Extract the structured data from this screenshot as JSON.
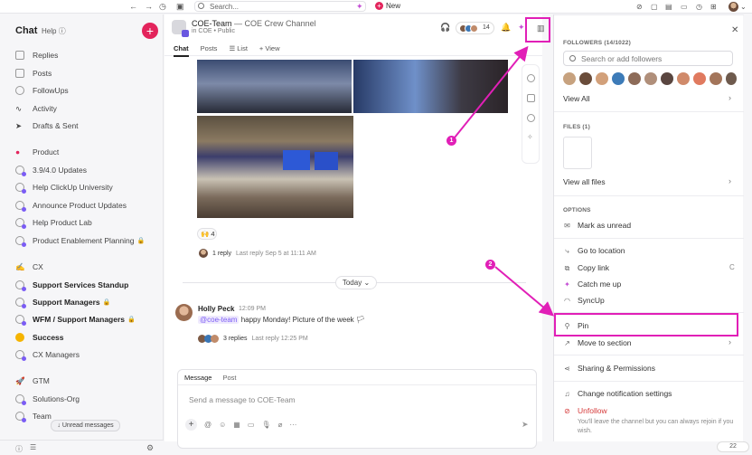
{
  "topbar": {
    "search_placeholder": "Search...",
    "new_label": "New"
  },
  "sidebar": {
    "title": "Chat",
    "help": "Help",
    "items": [
      {
        "label": "Replies",
        "icon": "replies-icon"
      },
      {
        "label": "Posts",
        "icon": "posts-icon"
      },
      {
        "label": "FollowUps",
        "icon": "followups-icon"
      },
      {
        "label": "Activity",
        "icon": "activity-icon"
      },
      {
        "label": "Drafts & Sent",
        "icon": "send-icon"
      }
    ],
    "groups": [
      {
        "label": "Product",
        "channels": [
          "3.9/4.0 Updates",
          "Help ClickUp University",
          "Announce Product Updates",
          "Help Product Lab",
          "Product Enablement Planning"
        ]
      },
      {
        "label": "CX",
        "channels": [
          "Support Services Standup",
          "Support Managers",
          "WFM / Support Managers",
          "Success",
          "CX Managers"
        ]
      },
      {
        "label": "GTM",
        "channels": [
          "Solutions-Org",
          "Team"
        ]
      }
    ],
    "unread_tip": "Unread messages"
  },
  "channel": {
    "name": "COE-Team",
    "dash": "—",
    "description": "COE Crew Channel",
    "sub": "in COE • Public",
    "member_count": "14",
    "tabs": [
      "Chat",
      "Posts",
      "List",
      "+ View"
    ]
  },
  "thread": {
    "reaction": "🙌 4",
    "reply_count": "1 reply",
    "reply_meta": "Last reply Sep 5 at 11:11 AM",
    "today": "Today"
  },
  "message": {
    "author": "Holly Peck",
    "time": "12:09 PM",
    "mention": "@coe-team",
    "text": "happy Monday! Picture of the week",
    "reply_count": "3 replies",
    "reply_meta": "Last reply 12:25 PM"
  },
  "composer": {
    "tab_message": "Message",
    "tab_post": "Post",
    "placeholder": "Send a message to COE-Team"
  },
  "right_panel": {
    "followers_title": "FOLLOWERS (14/1022)",
    "search_placeholder": "Search or add followers",
    "view_all": "View All",
    "files_title": "FILES (1)",
    "view_all_files": "View all files",
    "options_title": "OPTIONS",
    "options": [
      "Mark as unread",
      "Go to location",
      "Copy link",
      "Catch me up",
      "SyncUp",
      "Pin",
      "Move to section",
      "Sharing & Permissions",
      "Change notification settings",
      "Unfollow"
    ],
    "copy_link_shortcut": "C",
    "unfollow_note": "You'll leave the channel but you can always rejoin if you wish."
  },
  "annotations": {
    "step1": "1",
    "step2": "2",
    "color": "#e11fb7"
  },
  "bottom_badge": "22",
  "colors": {
    "accent": "#e3245c",
    "brand": "#7b5cf5"
  }
}
